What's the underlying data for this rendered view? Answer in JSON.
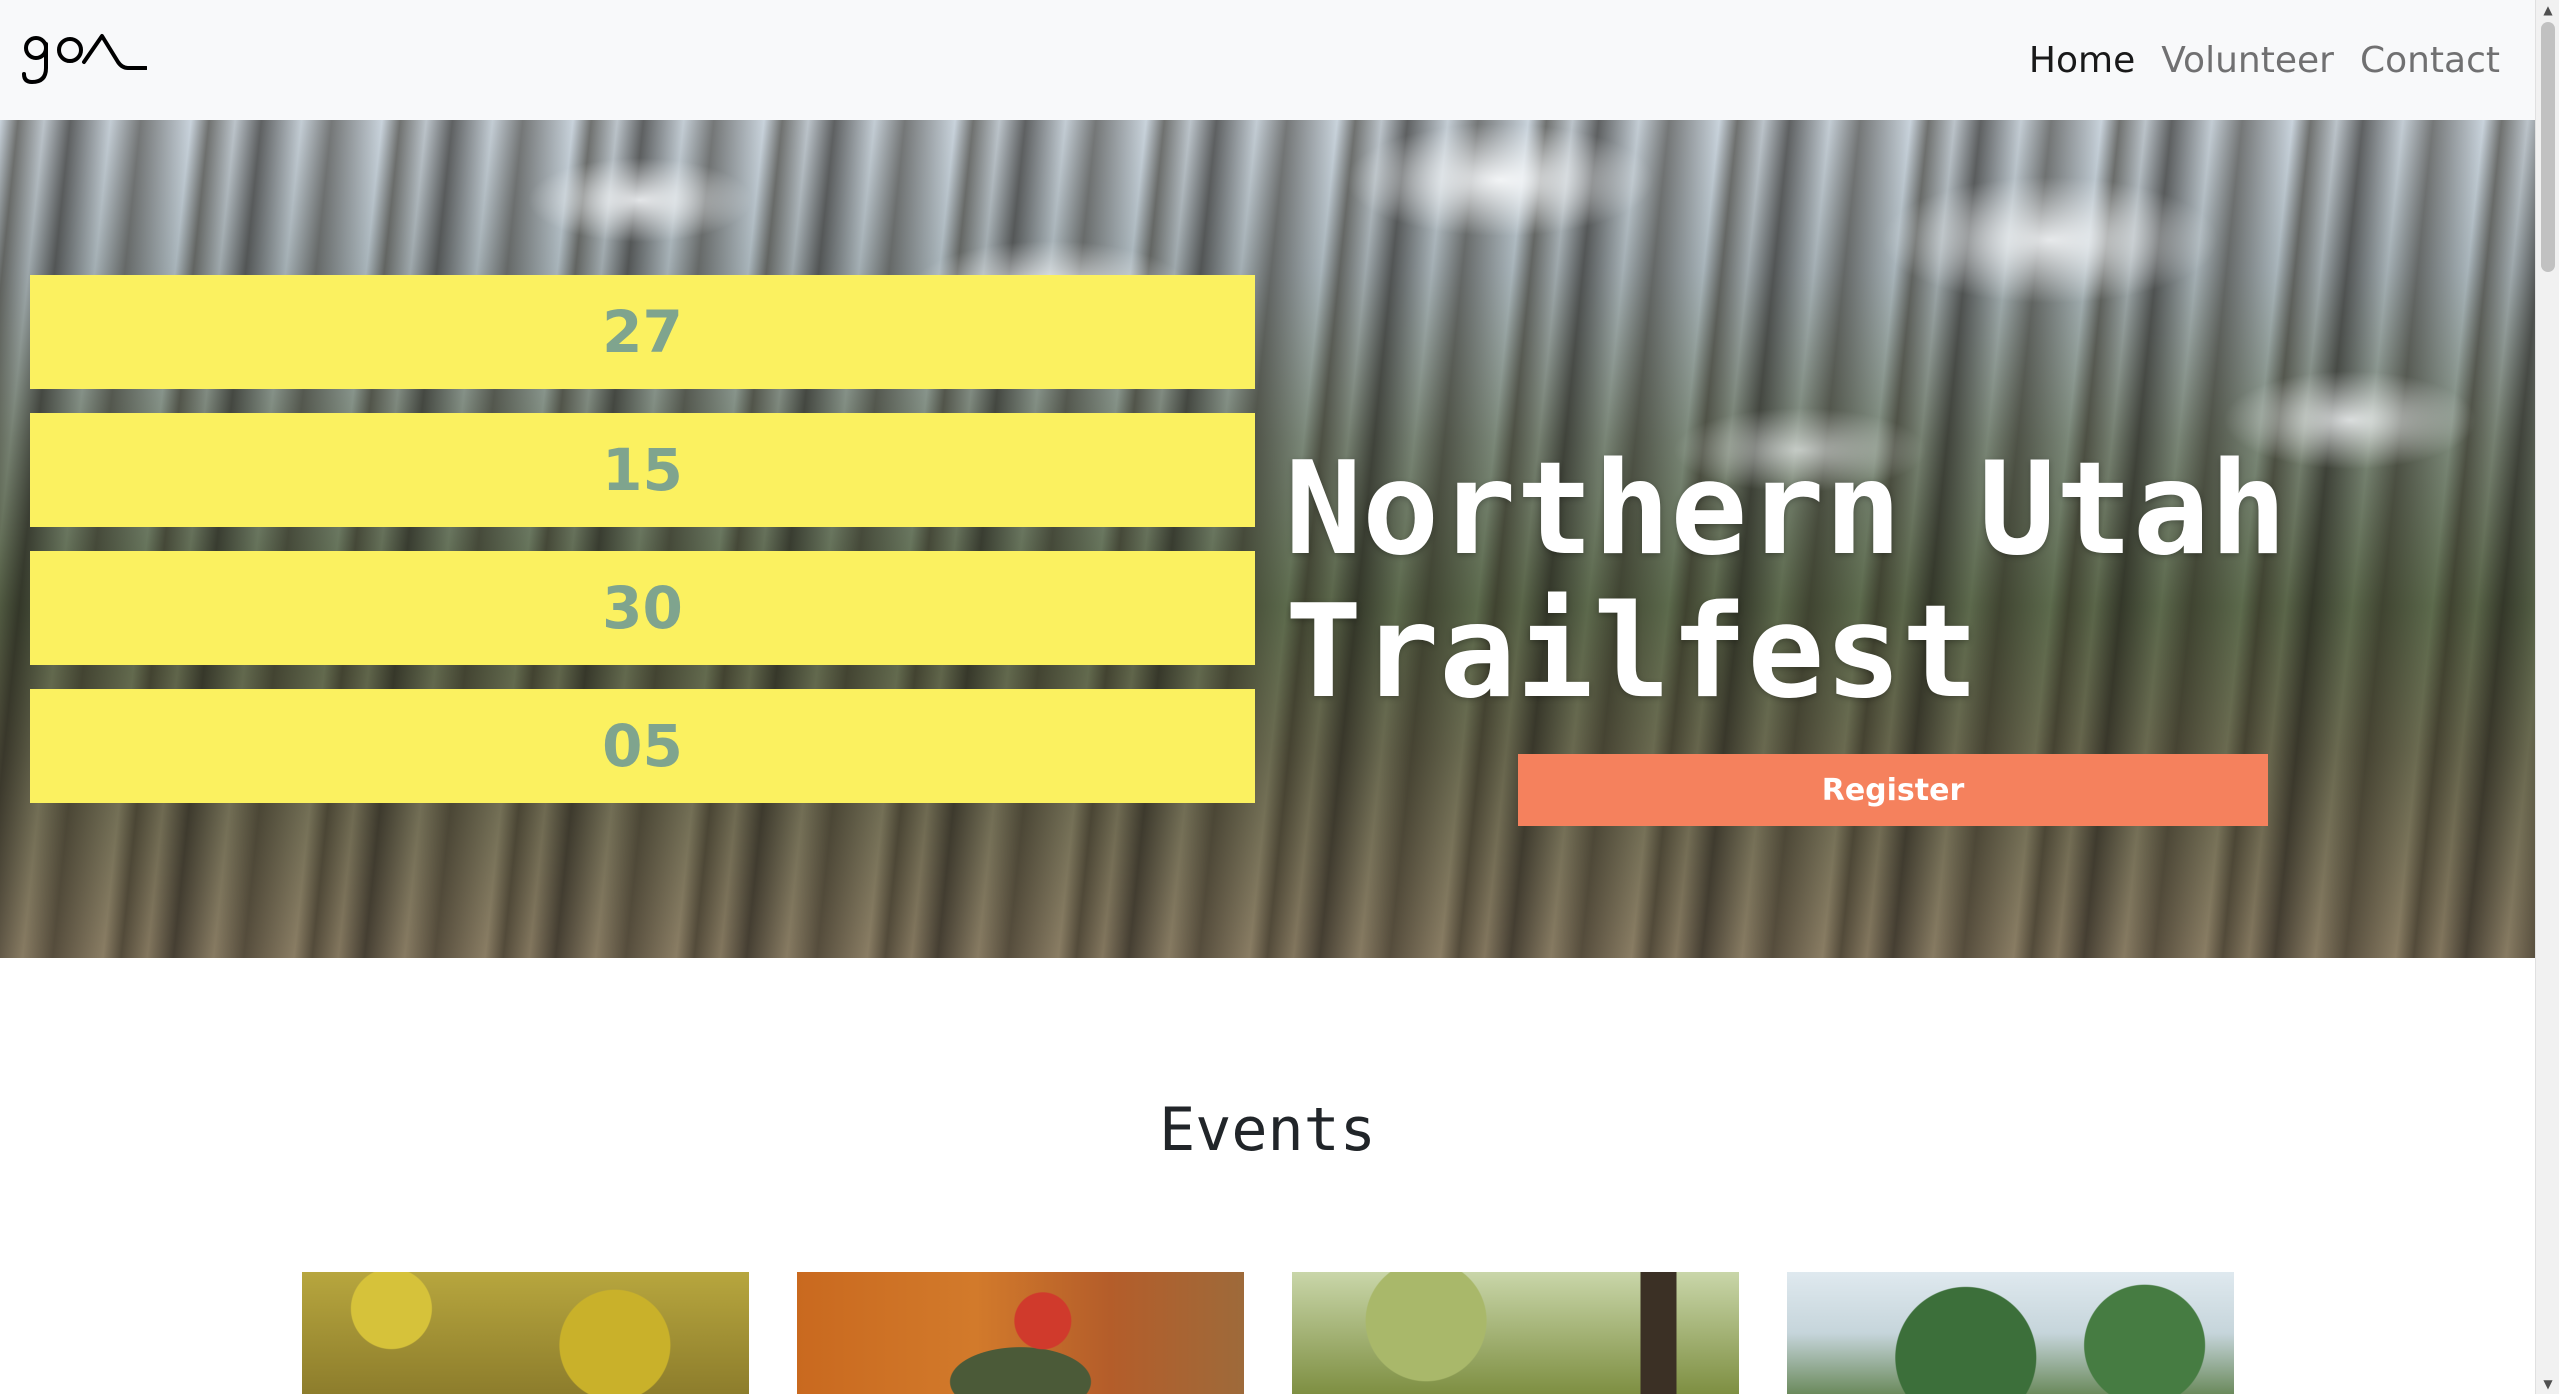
{
  "navbar": {
    "logo_text": "goa",
    "links": [
      {
        "label": "Home",
        "active": true
      },
      {
        "label": "Volunteer",
        "active": false
      },
      {
        "label": "Contact",
        "active": false
      }
    ]
  },
  "hero": {
    "countdown": [
      "27",
      "15",
      "30",
      "05"
    ],
    "title": "Northern Utah Trailfest",
    "register_label": "Register"
  },
  "events": {
    "heading": "Events",
    "cards": [
      {
        "image": "autumn-trail-photo"
      },
      {
        "image": "cyclist-photo"
      },
      {
        "image": "forest-photo"
      },
      {
        "image": "treetops-photo"
      }
    ]
  },
  "colors": {
    "countdown_bg": "#fbf160",
    "countdown_text": "#7fa48e",
    "register_bg": "#f5815d",
    "navbar_bg": "#f8f9fa"
  }
}
